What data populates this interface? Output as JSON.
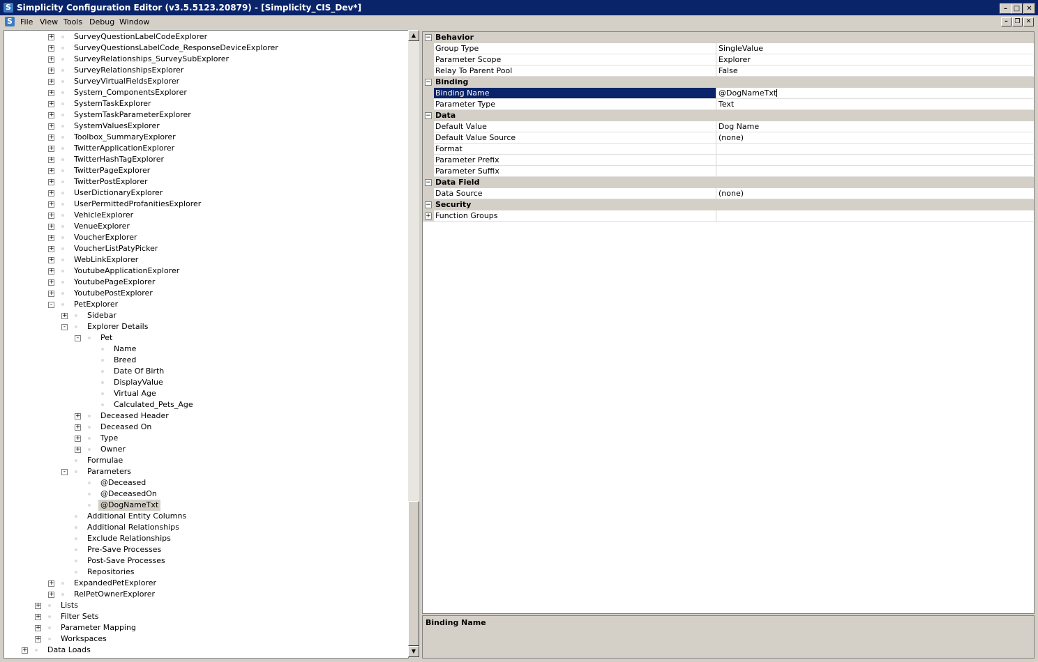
{
  "window": {
    "title": "Simplicity Configuration Editor (v3.5.5123.20879) - [Simplicity_CIS_Dev*]",
    "icon": "S",
    "controls": {
      "minimize": "–",
      "maximize": "□",
      "close": "✕"
    }
  },
  "menu": {
    "icon": "S",
    "items": [
      "File",
      "View",
      "Tools",
      "Debug",
      "Window"
    ],
    "mdi_controls": {
      "minimize": "–",
      "restore": "❐",
      "close": "✕"
    }
  },
  "tree": {
    "rows": [
      {
        "label": "SurveyQuestionLabelCodeExplorer",
        "level": 2,
        "expander": "+"
      },
      {
        "label": "SurveyQuestionsLabelCode_ResponseDeviceExplorer",
        "level": 2,
        "expander": "+"
      },
      {
        "label": "SurveyRelationships_SurveySubExplorer",
        "level": 2,
        "expander": "+"
      },
      {
        "label": "SurveyRelationshipsExplorer",
        "level": 2,
        "expander": "+"
      },
      {
        "label": "SurveyVirtualFieldsExplorer",
        "level": 2,
        "expander": "+"
      },
      {
        "label": "System_ComponentsExplorer",
        "level": 2,
        "expander": "+"
      },
      {
        "label": "SystemTaskExplorer",
        "level": 2,
        "expander": "+"
      },
      {
        "label": "SystemTaskParameterExplorer",
        "level": 2,
        "expander": "+"
      },
      {
        "label": "SystemValuesExplorer",
        "level": 2,
        "expander": "+"
      },
      {
        "label": "Toolbox_SummaryExplorer",
        "level": 2,
        "expander": "+"
      },
      {
        "label": "TwitterApplicationExplorer",
        "level": 2,
        "expander": "+"
      },
      {
        "label": "TwitterHashTagExplorer",
        "level": 2,
        "expander": "+"
      },
      {
        "label": "TwitterPageExplorer",
        "level": 2,
        "expander": "+"
      },
      {
        "label": "TwitterPostExplorer",
        "level": 2,
        "expander": "+"
      },
      {
        "label": "UserDictionaryExplorer",
        "level": 2,
        "expander": "+"
      },
      {
        "label": "UserPermittedProfanitiesExplorer",
        "level": 2,
        "expander": "+"
      },
      {
        "label": "VehicleExplorer",
        "level": 2,
        "expander": "+"
      },
      {
        "label": "VenueExplorer",
        "level": 2,
        "expander": "+"
      },
      {
        "label": "VoucherExplorer",
        "level": 2,
        "expander": "+"
      },
      {
        "label": "VoucherListPatyPicker",
        "level": 2,
        "expander": "+"
      },
      {
        "label": "WebLinkExplorer",
        "level": 2,
        "expander": "+"
      },
      {
        "label": "YoutubeApplicationExplorer",
        "level": 2,
        "expander": "+"
      },
      {
        "label": "YoutubePageExplorer",
        "level": 2,
        "expander": "+"
      },
      {
        "label": "YoutubePostExplorer",
        "level": 2,
        "expander": "+"
      },
      {
        "label": "PetExplorer",
        "level": 2,
        "expander": "-"
      },
      {
        "label": "Sidebar",
        "level": 3,
        "expander": "+"
      },
      {
        "label": "Explorer Details",
        "level": 3,
        "expander": "-"
      },
      {
        "label": "Pet",
        "level": 4,
        "expander": "-"
      },
      {
        "label": "Name",
        "level": 5,
        "expander": ""
      },
      {
        "label": "Breed",
        "level": 5,
        "expander": ""
      },
      {
        "label": "Date Of Birth",
        "level": 5,
        "expander": ""
      },
      {
        "label": "DisplayValue",
        "level": 5,
        "expander": ""
      },
      {
        "label": "Virtual Age",
        "level": 5,
        "expander": ""
      },
      {
        "label": "Calculated_Pets_Age",
        "level": 5,
        "expander": ""
      },
      {
        "label": "Deceased Header",
        "level": 4,
        "expander": "+"
      },
      {
        "label": "Deceased On",
        "level": 4,
        "expander": "+"
      },
      {
        "label": "Type",
        "level": 4,
        "expander": "+"
      },
      {
        "label": "Owner",
        "level": 4,
        "expander": "+"
      },
      {
        "label": "Formulae",
        "level": 3,
        "expander": ""
      },
      {
        "label": "Parameters",
        "level": 3,
        "expander": "-"
      },
      {
        "label": "@Deceased",
        "level": 4,
        "expander": ""
      },
      {
        "label": "@DeceasedOn",
        "level": 4,
        "expander": ""
      },
      {
        "label": "@DogNameTxt",
        "level": 4,
        "expander": "",
        "selected": true
      },
      {
        "label": "Additional Entity Columns",
        "level": 3,
        "expander": ""
      },
      {
        "label": "Additional Relationships",
        "level": 3,
        "expander": ""
      },
      {
        "label": "Exclude Relationships",
        "level": 3,
        "expander": ""
      },
      {
        "label": "Pre-Save Processes",
        "level": 3,
        "expander": ""
      },
      {
        "label": "Post-Save Processes",
        "level": 3,
        "expander": ""
      },
      {
        "label": "Repositories",
        "level": 3,
        "expander": ""
      },
      {
        "label": "ExpandedPetExplorer",
        "level": 2,
        "expander": "+"
      },
      {
        "label": "RelPetOwnerExplorer",
        "level": 2,
        "expander": "+"
      },
      {
        "label": "Lists",
        "level": 1,
        "expander": "+"
      },
      {
        "label": "Filter Sets",
        "level": 1,
        "expander": "+"
      },
      {
        "label": "Parameter Mapping",
        "level": 1,
        "expander": "+"
      },
      {
        "label": "Workspaces",
        "level": 1,
        "expander": "+"
      },
      {
        "label": "Data Loads",
        "level": 0,
        "expander": "+"
      }
    ]
  },
  "scrollbar": {
    "up": "▲",
    "down": "▼"
  },
  "properties": {
    "rows": [
      {
        "kind": "category",
        "name": "Behavior",
        "toggle": "−"
      },
      {
        "kind": "prop",
        "name": "Group Type",
        "value": "SingleValue"
      },
      {
        "kind": "prop",
        "name": "Parameter Scope",
        "value": "Explorer"
      },
      {
        "kind": "prop",
        "name": "Relay To Parent Pool",
        "value": "False"
      },
      {
        "kind": "category",
        "name": "Binding",
        "toggle": "−"
      },
      {
        "kind": "prop",
        "name": "Binding Name",
        "value": "@DogNameTxt",
        "selected": true
      },
      {
        "kind": "prop",
        "name": "Parameter Type",
        "value": "Text"
      },
      {
        "kind": "category",
        "name": "Data",
        "toggle": "−"
      },
      {
        "kind": "prop",
        "name": "Default Value",
        "value": "Dog Name"
      },
      {
        "kind": "prop",
        "name": "Default Value Source",
        "value": "(none)"
      },
      {
        "kind": "prop",
        "name": "Format",
        "value": ""
      },
      {
        "kind": "prop",
        "name": "Parameter Prefix",
        "value": ""
      },
      {
        "kind": "prop",
        "name": "Parameter Suffix",
        "value": ""
      },
      {
        "kind": "category",
        "name": "Data Field",
        "toggle": "−"
      },
      {
        "kind": "prop",
        "name": "Data Source",
        "value": "(none)"
      },
      {
        "kind": "category",
        "name": "Security",
        "toggle": "−"
      },
      {
        "kind": "prop",
        "name": "Function Groups",
        "value": "",
        "expander": "+"
      }
    ]
  },
  "help": {
    "title": "Binding Name"
  },
  "colors": {
    "selection": "#0a246a",
    "chrome": "#d4d0c8"
  }
}
